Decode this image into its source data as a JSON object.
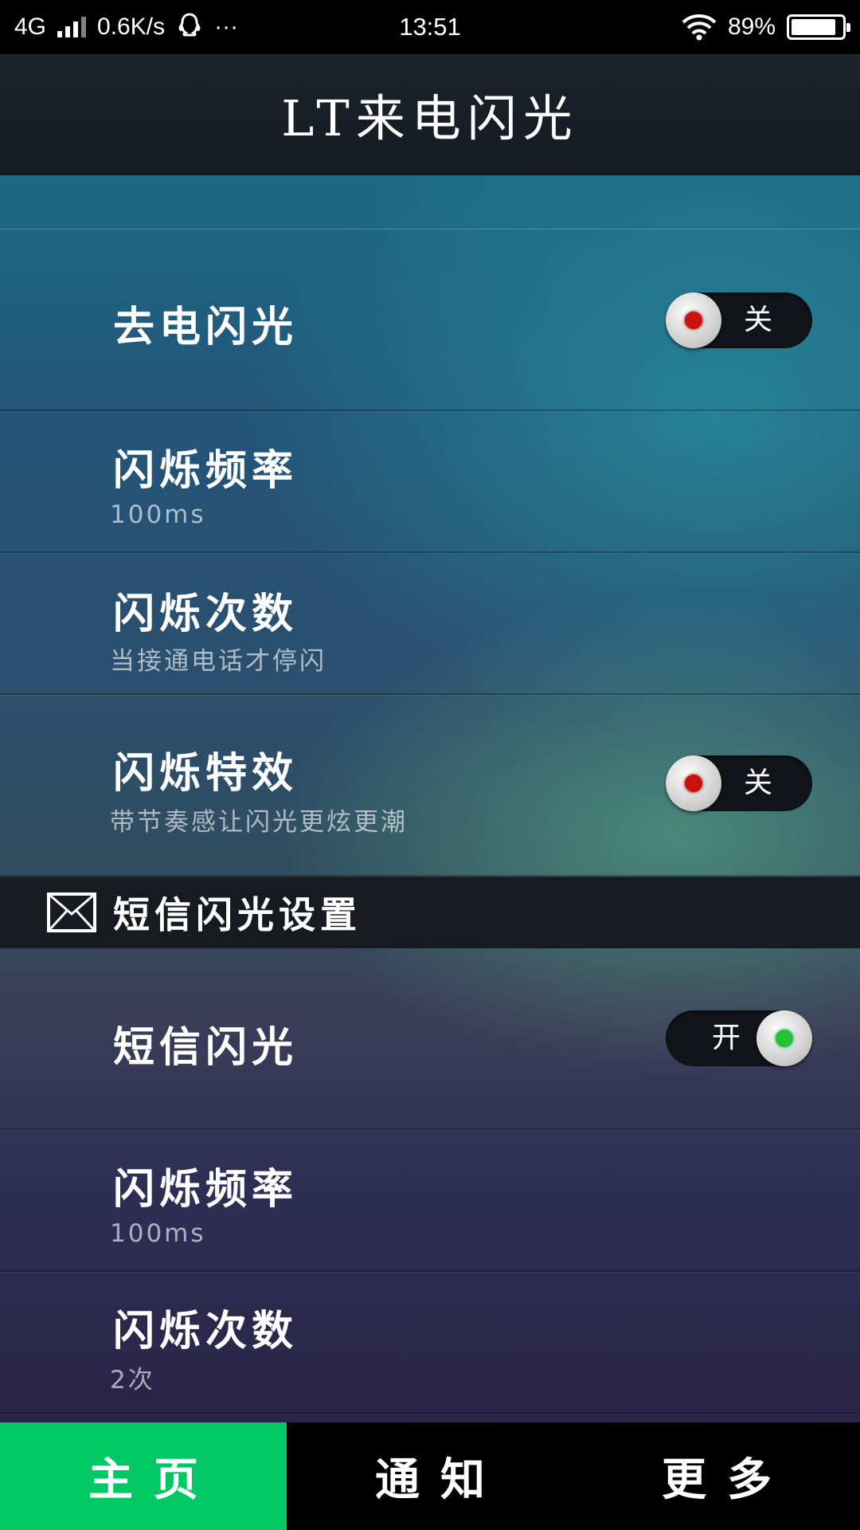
{
  "status_bar": {
    "network": "4G",
    "speed": "0.6K/s",
    "more": "···",
    "time": "13:51",
    "battery": "89%",
    "battery_level": 0.89
  },
  "app": {
    "title": "LT来电闪光"
  },
  "call_section": {
    "rows": [
      {
        "title": "去电闪光",
        "toggle": "关",
        "state": "off"
      },
      {
        "title": "闪烁频率",
        "sub": "100ms"
      },
      {
        "title": "闪烁次数",
        "sub": "当接通电话才停闪"
      },
      {
        "title": "闪烁特效",
        "sub": "带节奏感让闪光更炫更潮",
        "toggle": "关",
        "state": "off"
      }
    ]
  },
  "sms_section": {
    "header": "短信闪光设置",
    "header_icon": "envelope-icon",
    "rows": [
      {
        "title": "短信闪光",
        "toggle": "开",
        "state": "on"
      },
      {
        "title": "闪烁频率",
        "sub": "100ms"
      },
      {
        "title": "闪烁次数",
        "sub": "2次"
      }
    ]
  },
  "nav": {
    "tabs": [
      {
        "label": "主页",
        "active": true
      },
      {
        "label": "通知"
      },
      {
        "label": "更多"
      }
    ]
  },
  "colors": {
    "accent": "#00c864",
    "toggle_off_dot": "#cc1010",
    "toggle_on_dot": "#27c136"
  }
}
